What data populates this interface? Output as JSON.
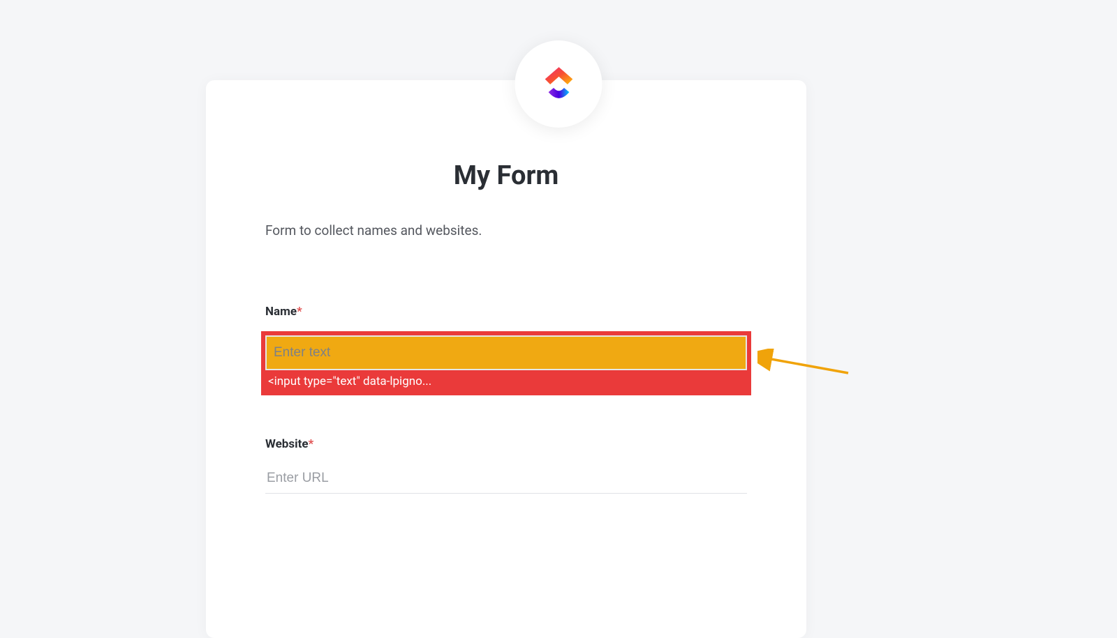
{
  "logo": {
    "name": "clickup-logo"
  },
  "form": {
    "title": "My Form",
    "description": "Form to collect names and websites.",
    "fields": [
      {
        "label": "Name",
        "required_mark": "*",
        "placeholder": "Enter text",
        "dev_snippet": "<input type=\"text\" data-lpigno..."
      },
      {
        "label": "Website",
        "required_mark": "*",
        "placeholder": "Enter URL"
      }
    ]
  },
  "annotation": {
    "arrow_color": "#f0a30a"
  }
}
